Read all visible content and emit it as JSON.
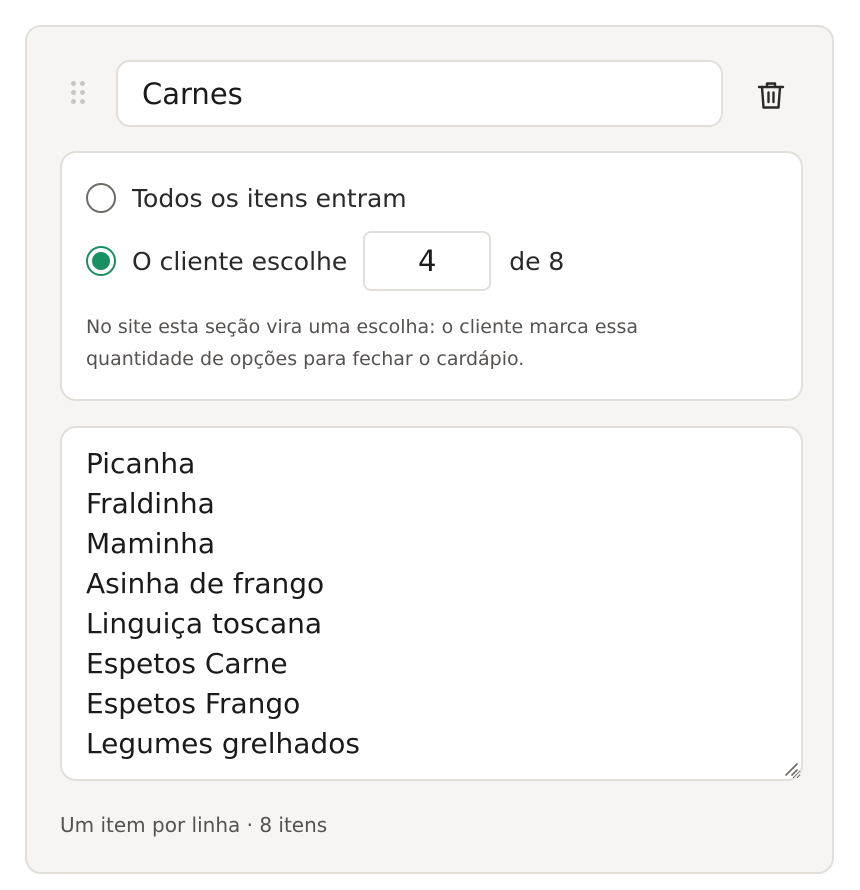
{
  "section": {
    "title_value": "Carnes",
    "delete_icon": "trash-icon",
    "drag_icon": "drag-handle-icon"
  },
  "mode": {
    "option_all_label": "Todos os itens entram",
    "option_choose_label": "O cliente escolhe",
    "selected": "choose",
    "choose_count": "4",
    "of_label": "de 8",
    "help_text": "No site esta seção vira uma escolha: o cliente marca essa quantidade de opções para fechar o cardápio."
  },
  "items": {
    "text": "Picanha\nFraldinha\nMaminha\nAsinha de frango\nLinguiça toscana\nEspetos Carne\nEspetos Frango\nLegumes grelhados",
    "footer": "Um item por linha · 8 itens"
  },
  "colors": {
    "accent": "#1a8f62",
    "card_background": "#f6f5f3",
    "border": "#e2dfda"
  }
}
